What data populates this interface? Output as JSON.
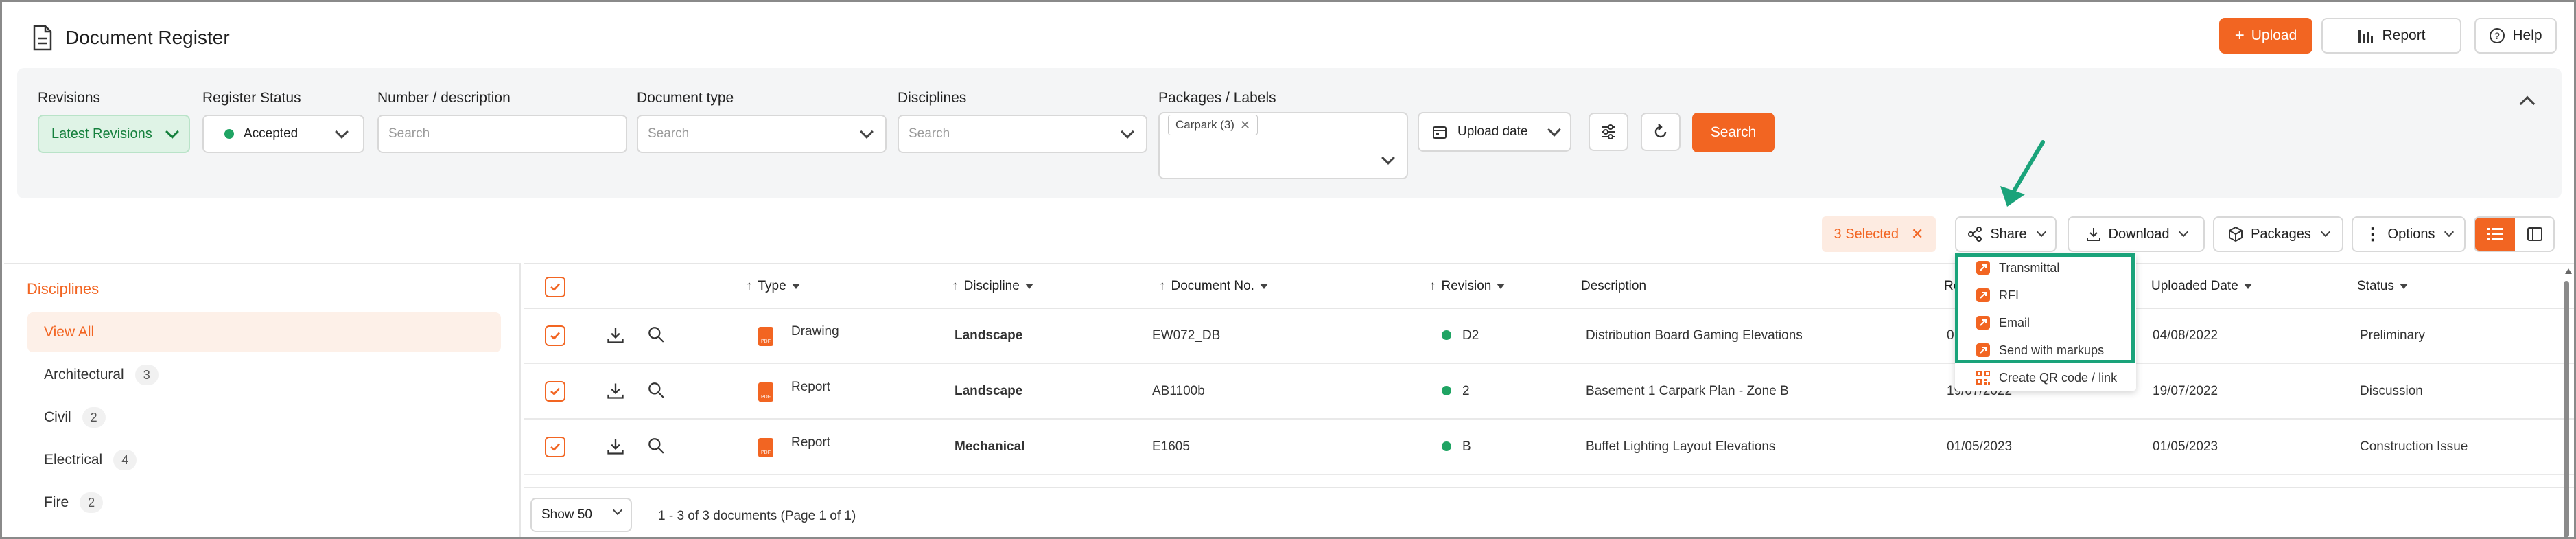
{
  "colors": {
    "accent": "#f26522",
    "status_green": "#1fa463",
    "highlight": "#1aa37a"
  },
  "header": {
    "title": "Document Register",
    "upload_label": "Upload",
    "report_label": "Report",
    "help_label": "Help"
  },
  "filters": {
    "revisions": {
      "label": "Revisions",
      "value": "Latest Revisions"
    },
    "register_status": {
      "label": "Register Status",
      "value": "Accepted"
    },
    "number_description": {
      "label": "Number / description",
      "placeholder": "Search"
    },
    "document_type": {
      "label": "Document type",
      "placeholder": "Search"
    },
    "disciplines": {
      "label": "Disciplines",
      "placeholder": "Search"
    },
    "packages": {
      "label": "Packages / Labels",
      "tag": "Carpark (3)"
    },
    "date_field": "Upload date",
    "search_button": "Search"
  },
  "toolbar": {
    "selected": "3 Selected",
    "share": "Share",
    "download": "Download",
    "packages": "Packages",
    "options": "Options"
  },
  "share_menu": [
    "Transmittal",
    "RFI",
    "Email",
    "Send with markups",
    "Create QR code / link"
  ],
  "sidebar": {
    "heading": "Disciplines",
    "items": [
      {
        "label": "View All",
        "count": ""
      },
      {
        "label": "Architectural",
        "count": "3"
      },
      {
        "label": "Civil",
        "count": "2"
      },
      {
        "label": "Electrical",
        "count": "4"
      },
      {
        "label": "Fire",
        "count": "2"
      }
    ]
  },
  "table": {
    "columns": {
      "type": "Type",
      "discipline": "Discipline",
      "document_no": "Document No.",
      "revision": "Revision",
      "description": "Description",
      "uploaded": "Uploaded Date",
      "status": "Status",
      "revised_partial": "Re"
    },
    "rows": [
      {
        "type": "Drawing",
        "discipline": "Landscape",
        "doc_no": "EW072_DB",
        "revision": "D2",
        "description": "Distribution Board Gaming Elevations",
        "rev_date": "0",
        "uploaded": "04/08/2022",
        "status": "Preliminary"
      },
      {
        "type": "Report",
        "discipline": "Landscape",
        "doc_no": "AB1100b",
        "revision": "2",
        "description": "Basement 1 Carpark Plan - Zone B",
        "rev_date": "19/07/2022",
        "uploaded": "19/07/2022",
        "status": "Discussion"
      },
      {
        "type": "Report",
        "discipline": "Mechanical",
        "doc_no": "E1605",
        "revision": "B",
        "description": "Buffet Lighting Layout Elevations",
        "rev_date": "01/05/2023",
        "uploaded": "01/05/2023",
        "status": "Construction Issue"
      }
    ],
    "pdf_label": "PDF"
  },
  "footer": {
    "show": "Show 50",
    "pager": "1 - 3 of 3 documents (Page 1 of 1)"
  }
}
